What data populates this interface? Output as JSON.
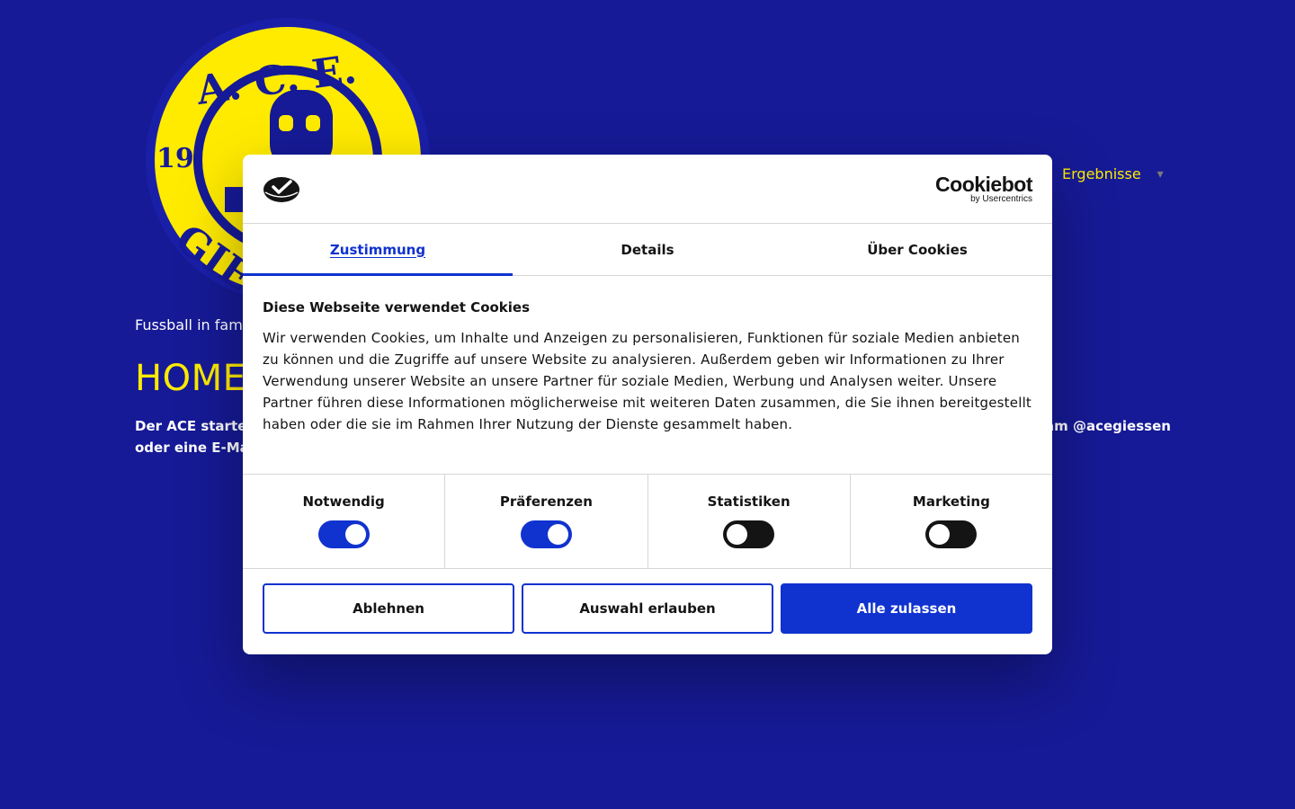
{
  "site": {
    "logo": {
      "top_text": "A. C. E.",
      "year_left": "19",
      "bottom_text": "GIESSEN",
      "brand_color": "#ffeb00",
      "ring_color": "#161a96"
    },
    "nav": {
      "link": "Ergebnisse",
      "caret_icon": "▾"
    },
    "tagline": "Fussball in famili",
    "page_title": "HOME",
    "body_lines": [
      "Der ACE startet r",
      "oder eine E-Mail",
      "am @acegiessen"
    ]
  },
  "cookie_dialog": {
    "brand": {
      "name": "Cookiebot",
      "sub": "by Usercentrics"
    },
    "tabs": [
      {
        "label": "Zustimmung",
        "active": true
      },
      {
        "label": "Details",
        "active": false
      },
      {
        "label": "Über Cookies",
        "active": false
      }
    ],
    "heading": "Diese Webseite verwendet Cookies",
    "text": "Wir verwenden Cookies, um Inhalte und Anzeigen zu personalisieren, Funktionen für soziale Medien anbieten zu können und die Zugriffe auf unsere Website zu analysieren. Außerdem geben wir Informationen zu Ihrer Verwendung unserer Website an unsere Partner für soziale Medien, Werbung und Analysen weiter. Unsere Partner führen diese Informationen möglicherweise mit weiteren Daten zusammen, die Sie ihnen bereitgestellt haben oder die sie im Rahmen Ihrer Nutzung der Dienste gesammelt haben.",
    "toggles": [
      {
        "label": "Notwendig",
        "on": true
      },
      {
        "label": "Präferenzen",
        "on": true
      },
      {
        "label": "Statistiken",
        "on": false
      },
      {
        "label": "Marketing",
        "on": false
      }
    ],
    "buttons": {
      "decline": "Ablehnen",
      "allow_selection": "Auswahl erlauben",
      "allow_all": "Alle zulassen"
    },
    "accent_color": "#1032cf"
  }
}
